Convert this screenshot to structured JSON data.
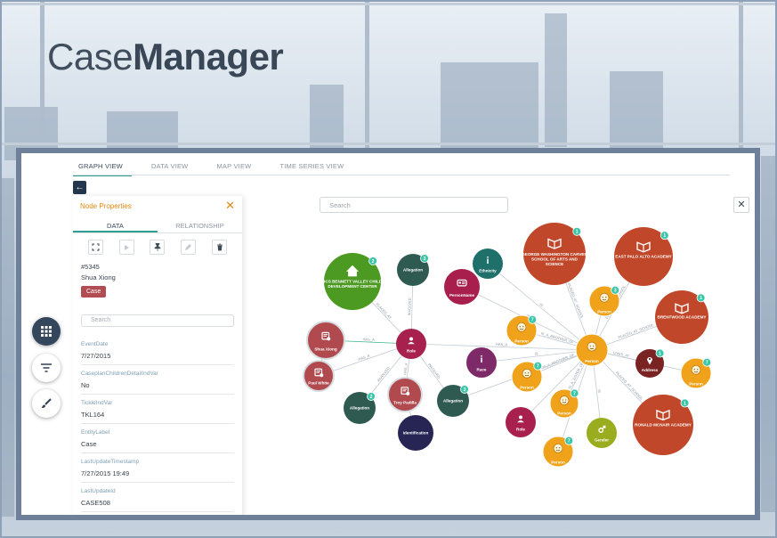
{
  "brand": {
    "light": "Case",
    "bold": "Manager"
  },
  "tabs": [
    "GRAPH VIEW",
    "DATA VIEW",
    "MAP VIEW",
    "TIME SERIES VIEW"
  ],
  "panel": {
    "title": "Node Properties",
    "tabs": [
      "DATA",
      "RELATIONSHIP"
    ],
    "record_id": "#5345",
    "record_name": "Shua Xiong",
    "record_tag": "Case",
    "search_placeholder": "Search",
    "properties": [
      {
        "key": "EventDate",
        "value": "7/27/2015"
      },
      {
        "key": "CaseplanChildrenDetailIndVar",
        "value": "No"
      },
      {
        "key": "TickleIndVar",
        "value": "TKL164"
      },
      {
        "key": "EntityLabel",
        "value": "Case"
      },
      {
        "key": "LastUpdateTimestamp",
        "value": "7/27/2015 19:49"
      },
      {
        "key": "LastUpdateId",
        "value": "CASE508"
      },
      {
        "key": "ActiveEnforcementCaseDate",
        "value": ""
      }
    ]
  },
  "graph": {
    "search_placeholder": "Search",
    "colors": {
      "school": "#c1472a",
      "person": "#f0a21a",
      "role": "#a8214e",
      "allegation": "#2f5a52",
      "identification": "#262553",
      "ethnicity": "#1f6f6a",
      "personname": "#a81f4d",
      "race": "#7e2a68",
      "address": "#7a2323",
      "gender": "#99ad1e",
      "location": "#4c9a22",
      "case": "#b04a4e",
      "badge": "#3cc6a9",
      "edge": "#c2cbd4"
    },
    "nodes": [
      {
        "id": "n1",
        "label": "GEORGE WASHINGTON CARVER SCHOOL OF ARTS AND SCIENCE",
        "type": "school",
        "icon": "book-icon",
        "badge": "1"
      },
      {
        "id": "n2",
        "label": "EAST PALO ALTO ACADEMY",
        "type": "school",
        "icon": "book-icon",
        "badge": "1"
      },
      {
        "id": "n3",
        "label": "BRENTWOOD ACADEMY",
        "type": "school",
        "icon": "book-icon",
        "badge": "1"
      },
      {
        "id": "n4",
        "label": "RONALD MCNAIR ACADEMY",
        "type": "school",
        "icon": "book-icon",
        "badge": "1"
      },
      {
        "id": "n5",
        "label": "4CS BENNETT VALLEY CHILD DEVELOPMENT CENTER",
        "type": "location",
        "icon": "home-icon",
        "badge": "2"
      },
      {
        "id": "n6",
        "label": "Allegation",
        "type": "allegation",
        "icon": "",
        "badge": "3"
      },
      {
        "id": "n7",
        "label": "PersonName",
        "type": "personname",
        "icon": "id-card-icon",
        "badge": ""
      },
      {
        "id": "n8",
        "label": "Ethnicity",
        "type": "ethnicity",
        "icon": "info-icon",
        "badge": ""
      },
      {
        "id": "n9",
        "label": "Person",
        "type": "person",
        "icon": "face-icon",
        "badge": "3"
      },
      {
        "id": "n10",
        "label": "Person",
        "type": "person",
        "icon": "face-icon",
        "badge": "7"
      },
      {
        "id": "n11",
        "label": "Shua Xiong",
        "type": "case",
        "icon": "case-file-icon",
        "badge": ""
      },
      {
        "id": "n12",
        "label": "Role",
        "type": "role",
        "icon": "user-icon",
        "badge": ""
      },
      {
        "id": "n13",
        "label": "Race",
        "type": "race",
        "icon": "info-icon",
        "badge": ""
      },
      {
        "id": "n14",
        "label": "Person",
        "type": "person",
        "icon": "face-icon",
        "badge": ""
      },
      {
        "id": "n15",
        "label": "Address",
        "type": "address",
        "icon": "pin-icon",
        "badge": "1"
      },
      {
        "id": "n16",
        "label": "Person",
        "type": "person",
        "icon": "face-icon",
        "badge": "7"
      },
      {
        "id": "n17",
        "label": "Paul White",
        "type": "case",
        "icon": "case-file-icon",
        "badge": ""
      },
      {
        "id": "n18",
        "label": "Person",
        "type": "person",
        "icon": "face-icon",
        "badge": "7"
      },
      {
        "id": "n19",
        "label": "Troy Padilla",
        "type": "case",
        "icon": "case-file-icon",
        "badge": ""
      },
      {
        "id": "n20",
        "label": "Allegation",
        "type": "allegation",
        "icon": "",
        "badge": "3"
      },
      {
        "id": "n21",
        "label": "Person",
        "type": "person",
        "icon": "face-icon",
        "badge": "7"
      },
      {
        "id": "n22",
        "label": "Allegation",
        "type": "allegation",
        "icon": "",
        "badge": "2"
      },
      {
        "id": "n23",
        "label": "Identification",
        "type": "identification",
        "icon": "",
        "badge": ""
      },
      {
        "id": "n24",
        "label": "Role",
        "type": "role",
        "icon": "user-icon",
        "badge": ""
      },
      {
        "id": "n25",
        "label": "Gender",
        "type": "gender",
        "icon": "gender-icon",
        "badge": ""
      },
      {
        "id": "n26",
        "label": "Person",
        "type": "person",
        "icon": "face-icon",
        "badge": "7"
      },
      {
        "id": "n27",
        "label": "Person",
        "type": "person",
        "icon": "face-icon",
        "badge": "7"
      }
    ],
    "edges": [
      {
        "from": "n14",
        "to": "n1",
        "label": "PLACED_AT_SCHOOL"
      },
      {
        "from": "n14",
        "to": "n2",
        "label": "PLACED_AT_SCHOOL"
      },
      {
        "from": "n14",
        "to": "n3",
        "label": "PLACED_AT_SCHOOL"
      },
      {
        "from": "n14",
        "to": "n4",
        "label": "PLACED_AT_SCHOOL"
      },
      {
        "from": "n14",
        "to": "n15",
        "label": "LIVES_AT"
      },
      {
        "from": "n14",
        "to": "n9",
        "label": ""
      },
      {
        "from": "n14",
        "to": "n10",
        "label": "IS_A_BROTHER_OF"
      },
      {
        "from": "n14",
        "to": "n18",
        "label": "IS_A_BROTHER_OF"
      },
      {
        "from": "n14",
        "to": "n16",
        "label": ""
      },
      {
        "from": "n14",
        "to": "n21",
        "label": "IS_A_SISTER_OF"
      },
      {
        "from": "n14",
        "to": "n25",
        "label": "IS"
      },
      {
        "from": "n14",
        "to": "n13",
        "label": "IS"
      },
      {
        "from": "n14",
        "to": "n7",
        "label": "IS"
      },
      {
        "from": "n14",
        "to": "n8",
        "label": "IS"
      },
      {
        "from": "n14",
        "to": "n26",
        "label": ""
      },
      {
        "from": "n14",
        "to": "n24",
        "label": ""
      },
      {
        "from": "n14",
        "to": "n12",
        "label": "HAS_A"
      },
      {
        "from": "n20",
        "to": "n14",
        "label": "HAS_A"
      },
      {
        "from": "n12",
        "to": "n11",
        "label": "HAS_A"
      },
      {
        "from": "n12",
        "to": "n5",
        "label": "PLACED_AT"
      },
      {
        "from": "n12",
        "to": "n6",
        "label": "INVOLVED"
      },
      {
        "from": "n12",
        "to": "n17",
        "label": "HAS_A"
      },
      {
        "from": "n12",
        "to": "n22",
        "label": "INVOLVED"
      },
      {
        "from": "n12",
        "to": "n19",
        "label": "HAS_A"
      },
      {
        "from": "n12",
        "to": "n20",
        "label": "INVOLVED"
      },
      {
        "from": "n19",
        "to": "n23",
        "label": ""
      },
      {
        "from": "n11",
        "to": "n17",
        "label": ""
      }
    ]
  }
}
